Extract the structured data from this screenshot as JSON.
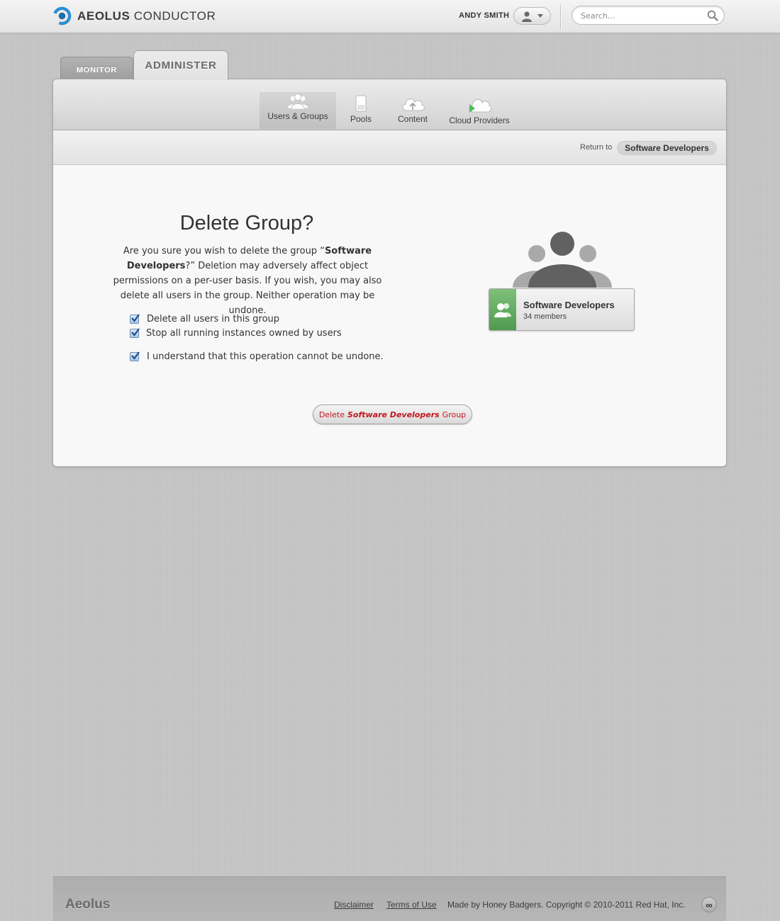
{
  "header": {
    "brand_bold": "AEOLUS",
    "brand_rest": " CONDUCTOR",
    "user_name": "ANDY SMITH",
    "search_placeholder": "Search..."
  },
  "tabs": {
    "monitor": "MONITOR",
    "administer": "ADMINISTER"
  },
  "subnav": {
    "items": [
      {
        "label": "Users & Groups",
        "icon": "users-icon",
        "active": true
      },
      {
        "label": "Pools",
        "icon": "pools-icon",
        "active": false
      },
      {
        "label": "Content",
        "icon": "cloud-upload-icon",
        "active": false
      },
      {
        "label": "Cloud Providers",
        "icon": "cloud-provider-icon",
        "active": false
      }
    ]
  },
  "return_bar": {
    "label": "Return to",
    "target": "Software Developers"
  },
  "dialog": {
    "title": "Delete Group?",
    "intro_1": "Are you sure you wish to delete the group “",
    "intro_group": "Software Developers",
    "intro_2": "?” Deletion may adversely affect object permissions on a per-user basis. If you wish, you may also delete all users in the group. Neither operation may be undone.",
    "options": [
      {
        "label": "Delete all users in this group",
        "checked": true
      },
      {
        "label": "Stop all running instances owned by users",
        "checked": true
      },
      {
        "label": "I understand that this operation cannot be undone.",
        "checked": true
      }
    ],
    "delete_prefix": "Delete",
    "delete_group_name": "Software Developers",
    "delete_suffix": "Group"
  },
  "group_card": {
    "name": "Software Developers",
    "members": "34 members"
  },
  "footer": {
    "brand": "Aeolus",
    "disclaimer": "Disclaimer",
    "terms": "Terms of Use",
    "copyright": "Made by Honey Badgers. Copyright © 2010-2011 Red Hat, Inc.",
    "badge": "∞"
  },
  "colors": {
    "danger": "#c4161c",
    "group_green": "#5fa85c",
    "checkbox_blue": "#3d76c2"
  }
}
